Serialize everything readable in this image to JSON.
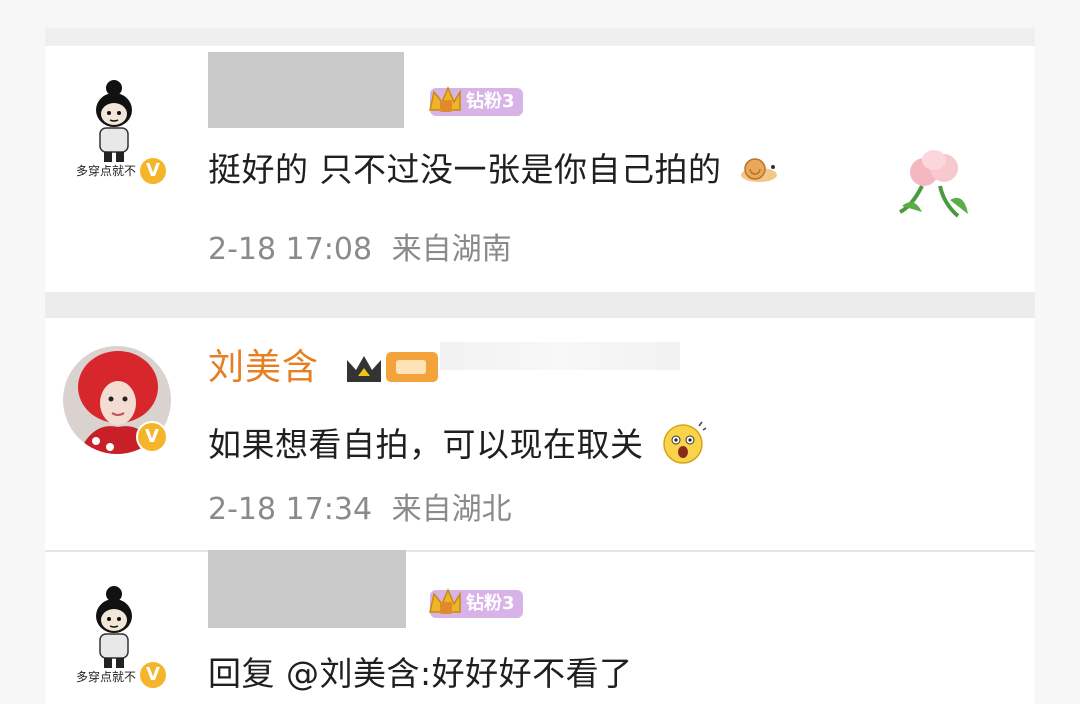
{
  "comments": [
    {
      "username_hidden": true,
      "fan_badge": "钻粉3",
      "text": "挺好的 只不过没一张是你自己拍的",
      "time": "2-18 17:08",
      "location": "来自湖南",
      "avatar_caption": "多穿点就不",
      "verified_mark": "V"
    },
    {
      "username": "刘美含",
      "fan_badge": "",
      "text": "如果想看自拍，可以现在取关",
      "time": "2-18 17:34",
      "location": "来自湖北",
      "verified_mark": "V"
    },
    {
      "username_hidden": true,
      "fan_badge": "钻粉3",
      "text": "回复 @刘美含:好好好不看了",
      "avatar_caption": "多穿点就不",
      "verified_mark": "V"
    }
  ],
  "colors": {
    "username": "#e67e22",
    "comment_text": "#1f1f1f",
    "meta_text": "#8a8a8a",
    "fan_badge_bg": "#d7b3e8",
    "vip_badge": "#f5b52b"
  },
  "icons": [
    "fan-crown-icon",
    "snail-emoji-icon",
    "tulip-emoji-icon",
    "king-crown-icon",
    "surprised-emoji-icon",
    "verified-v-icon"
  ]
}
